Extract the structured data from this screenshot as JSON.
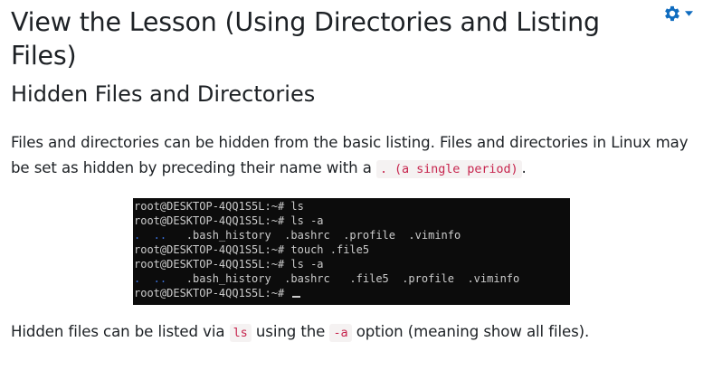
{
  "page_title": "View the Lesson (Using Directories and Listing Files)",
  "section_title": "Hidden Files and Directories",
  "paragraph1": {
    "text": "Files and directories can be hidden from the basic listing. Files and directories in Linux may be set as hidden by preceding their name with a ",
    "code": ". (a single period)",
    "end": "."
  },
  "terminal": {
    "prompt": "root@DESKTOP-4QQ1S5L:~#",
    "lines": [
      {
        "cmd": " ls"
      },
      {
        "cmd": " ls -a"
      },
      {
        "dirs": ".  ..",
        "files": "   .bash_history  .bashrc  .profile  .viminfo"
      },
      {
        "cmd": " touch .file5"
      },
      {
        "cmd": " ls -a"
      },
      {
        "dirs": ".  ..",
        "files": "   .bash_history  .bashrc   .file5  .profile  .viminfo"
      },
      {
        "cmd": " "
      }
    ]
  },
  "paragraph2": {
    "pre": "Hidden files can be listed via ",
    "code1": "ls",
    "mid": " using the ",
    "code2": "-a",
    "post": " option (meaning show all files)."
  },
  "icons": {
    "settings": "gear-icon",
    "settings_caret": "caret-down-icon"
  },
  "colors": {
    "accent": "#0f6cbf",
    "code_text": "#c7254e",
    "terminal_bg": "#0c0c0c",
    "terminal_dir": "#3a6fd8"
  }
}
